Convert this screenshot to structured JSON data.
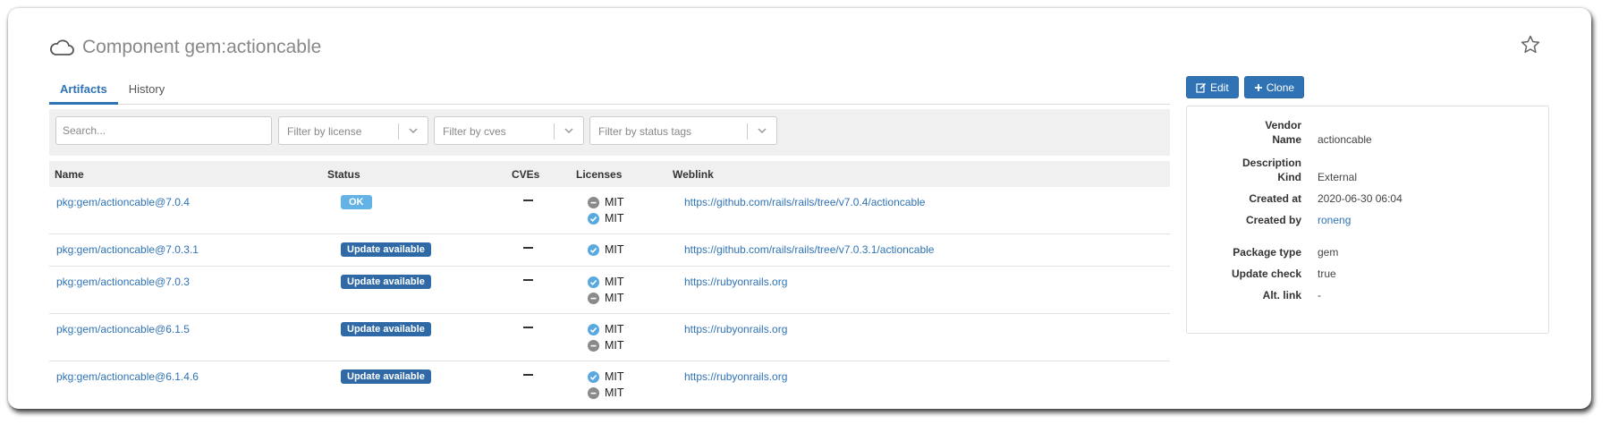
{
  "header": {
    "title": "Component gem:actioncable"
  },
  "tabs": [
    {
      "label": "Artifacts",
      "active": true
    },
    {
      "label": "History",
      "active": false
    }
  ],
  "filters": {
    "search_placeholder": "Search...",
    "license_placeholder": "Filter by license",
    "cves_placeholder": "Filter by cves",
    "status_tags_placeholder": "Filter by status tags"
  },
  "table": {
    "columns": [
      "Name",
      "Status",
      "CVEs",
      "Licenses",
      "Weblink"
    ],
    "rows": [
      {
        "name": "pkg:gem/actioncable@7.0.4",
        "status": "OK",
        "status_kind": "ok",
        "cves": "—",
        "licenses": [
          {
            "name": "MIT",
            "state": "minus"
          },
          {
            "name": "MIT",
            "state": "check"
          }
        ],
        "weblink": "https://github.com/rails/rails/tree/v7.0.4/actioncable"
      },
      {
        "name": "pkg:gem/actioncable@7.0.3.1",
        "status": "Update available",
        "status_kind": "update",
        "cves": "—",
        "licenses": [
          {
            "name": "MIT",
            "state": "check"
          }
        ],
        "weblink": "https://github.com/rails/rails/tree/v7.0.3.1/actioncable"
      },
      {
        "name": "pkg:gem/actioncable@7.0.3",
        "status": "Update available",
        "status_kind": "update",
        "cves": "—",
        "licenses": [
          {
            "name": "MIT",
            "state": "check"
          },
          {
            "name": "MIT",
            "state": "minus"
          }
        ],
        "weblink": "https://rubyonrails.org"
      },
      {
        "name": "pkg:gem/actioncable@6.1.5",
        "status": "Update available",
        "status_kind": "update",
        "cves": "—",
        "licenses": [
          {
            "name": "MIT",
            "state": "check"
          },
          {
            "name": "MIT",
            "state": "minus"
          }
        ],
        "weblink": "https://rubyonrails.org"
      },
      {
        "name": "pkg:gem/actioncable@6.1.4.6",
        "status": "Update available",
        "status_kind": "update",
        "cves": "—",
        "licenses": [
          {
            "name": "MIT",
            "state": "check"
          },
          {
            "name": "MIT",
            "state": "minus"
          }
        ],
        "weblink": "https://rubyonrails.org"
      }
    ]
  },
  "actions": {
    "edit_label": "Edit",
    "clone_label": "Clone"
  },
  "details": {
    "vendor_label": "Vendor",
    "vendor_value": "",
    "name_label": "Name",
    "name_value": "actioncable",
    "description_label": "Description",
    "description_value": "",
    "kind_label": "Kind",
    "kind_value": "External",
    "created_at_label": "Created at",
    "created_at_value": "2020-06-30 06:04",
    "created_by_label": "Created by",
    "created_by_value": "roneng",
    "package_type_label": "Package type",
    "package_type_value": "gem",
    "update_check_label": "Update check",
    "update_check_value": "true",
    "alt_link_label": "Alt. link",
    "alt_link_value": "-"
  },
  "colors": {
    "accent": "#2f73b5",
    "ok_badge": "#63b3e6",
    "update_badge": "#2f6aa6",
    "check_icon": "#5aa8e0",
    "minus_icon": "#8a8a8a"
  }
}
